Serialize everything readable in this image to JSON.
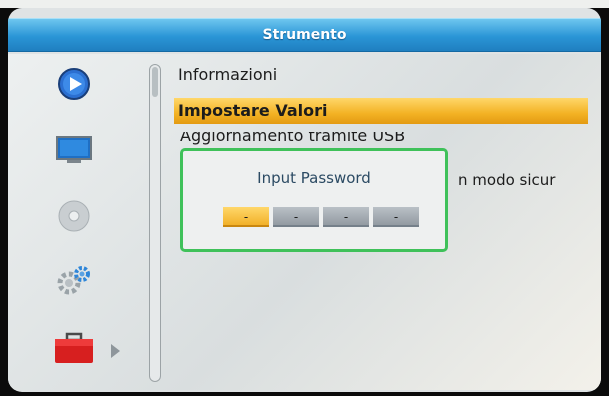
{
  "window": {
    "title": "Strumento"
  },
  "sidebar": {
    "items": [
      {
        "icon": "play-icon"
      },
      {
        "icon": "monitor-icon"
      },
      {
        "icon": "disc-icon"
      },
      {
        "icon": "gears-icon"
      },
      {
        "icon": "toolbox-icon",
        "selected": true
      }
    ]
  },
  "menu": {
    "items": [
      {
        "label": "Informazioni"
      },
      {
        "label": "Impostare Valori",
        "selected": true
      },
      {
        "label": "Aggiornamento tramite USB"
      },
      {
        "label": "n modo sicur"
      }
    ]
  },
  "dialog": {
    "title": "Input Password",
    "fields": [
      "-",
      "-",
      "-",
      "-"
    ],
    "active_index": 0
  },
  "colors": {
    "title_bar": "#2a95d6",
    "selection": "#f3b224",
    "dialog_border": "#3fc15a",
    "field_inactive": "#8f979e"
  }
}
